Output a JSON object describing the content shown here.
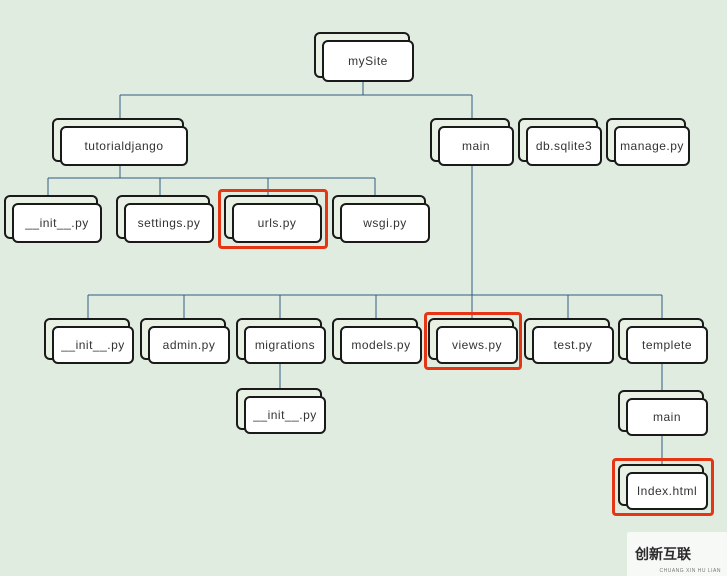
{
  "diagram": {
    "root": "mySite",
    "level1": {
      "tutorialdjango": "tutorialdjango",
      "main": "main",
      "db": "db.sqlite3",
      "manage": "manage.py"
    },
    "tutorial_children": {
      "init": "__init__.py",
      "settings": "settings.py",
      "urls": "urls.py",
      "wsgi": "wsgi.py"
    },
    "main_children": {
      "init": "__init__.py",
      "admin": "admin.py",
      "migrations": "migrations",
      "models": "models.py",
      "views": "views.py",
      "test": "test.py",
      "templete": "templete"
    },
    "migrations_children": {
      "init": "__init__.py"
    },
    "templete_children": {
      "main": "main"
    },
    "templete_main_children": {
      "index": "Index.html"
    }
  },
  "highlights": [
    "urls.py",
    "views.py",
    "Index.html"
  ],
  "watermark": {
    "brand": "创新互联",
    "sub": "CHUANG XIN HU LIAN"
  },
  "colors": {
    "bg": "#e0ecdf",
    "cardFront": "#ffffff",
    "cardBack": "#e9f1e4",
    "border": "#1a1a1a",
    "connector": "#2f5b82",
    "highlight": "#e53514"
  }
}
